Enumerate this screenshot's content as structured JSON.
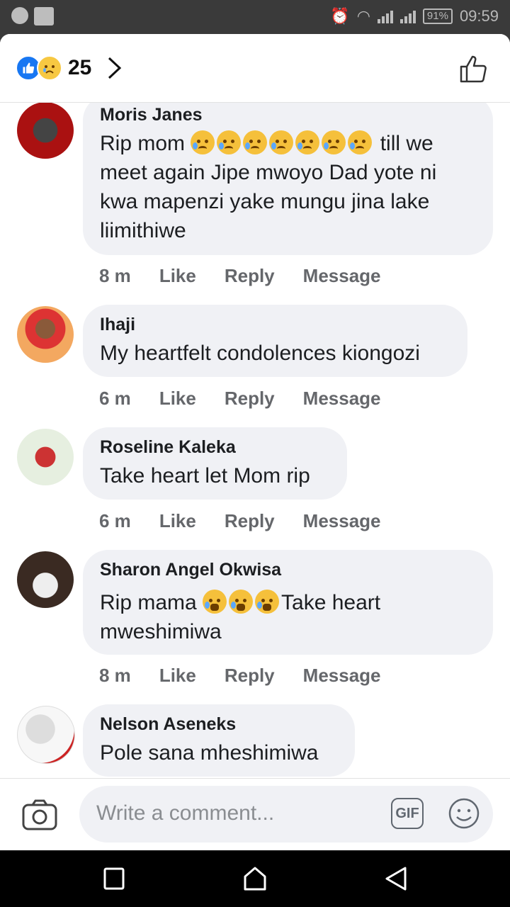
{
  "status_bar": {
    "time": "09:59",
    "battery": "91%"
  },
  "header": {
    "reaction_count": "25"
  },
  "comments": [
    {
      "author": "Moris Janes",
      "lines": [
        "Rip mom",
        "till we",
        "meet again Jipe mwoyo Dad yote ni",
        "kwa mapenzi yake mungu jina lake",
        "liimithiwe"
      ],
      "time": "8 m",
      "like": "Like",
      "reply": "Reply",
      "message": "Message"
    },
    {
      "author": "Ihaji",
      "lines": [
        "My heartfelt condolences kiongozi"
      ],
      "time": "6 m",
      "like": "Like",
      "reply": "Reply",
      "message": "Message"
    },
    {
      "author": "Roseline Kaleka",
      "lines": [
        "Take heart let Mom rip"
      ],
      "time": "6 m",
      "like": "Like",
      "reply": "Reply",
      "message": "Message"
    },
    {
      "author": "Sharon Angel Okwisa",
      "lines": [
        "Rip mama",
        "Take heart",
        "mweshimiwa"
      ],
      "time": "8 m",
      "like": "Like",
      "reply": "Reply",
      "message": "Message"
    },
    {
      "author": "Nelson Aseneks",
      "lines": [
        "Pole sana mheshimiwa"
      ]
    }
  ],
  "composer": {
    "placeholder": "Write a comment...",
    "gif_label": "GIF"
  },
  "colors": {
    "accent": "#1877f2",
    "bubble": "#f0f1f5",
    "meta": "#65676b"
  }
}
